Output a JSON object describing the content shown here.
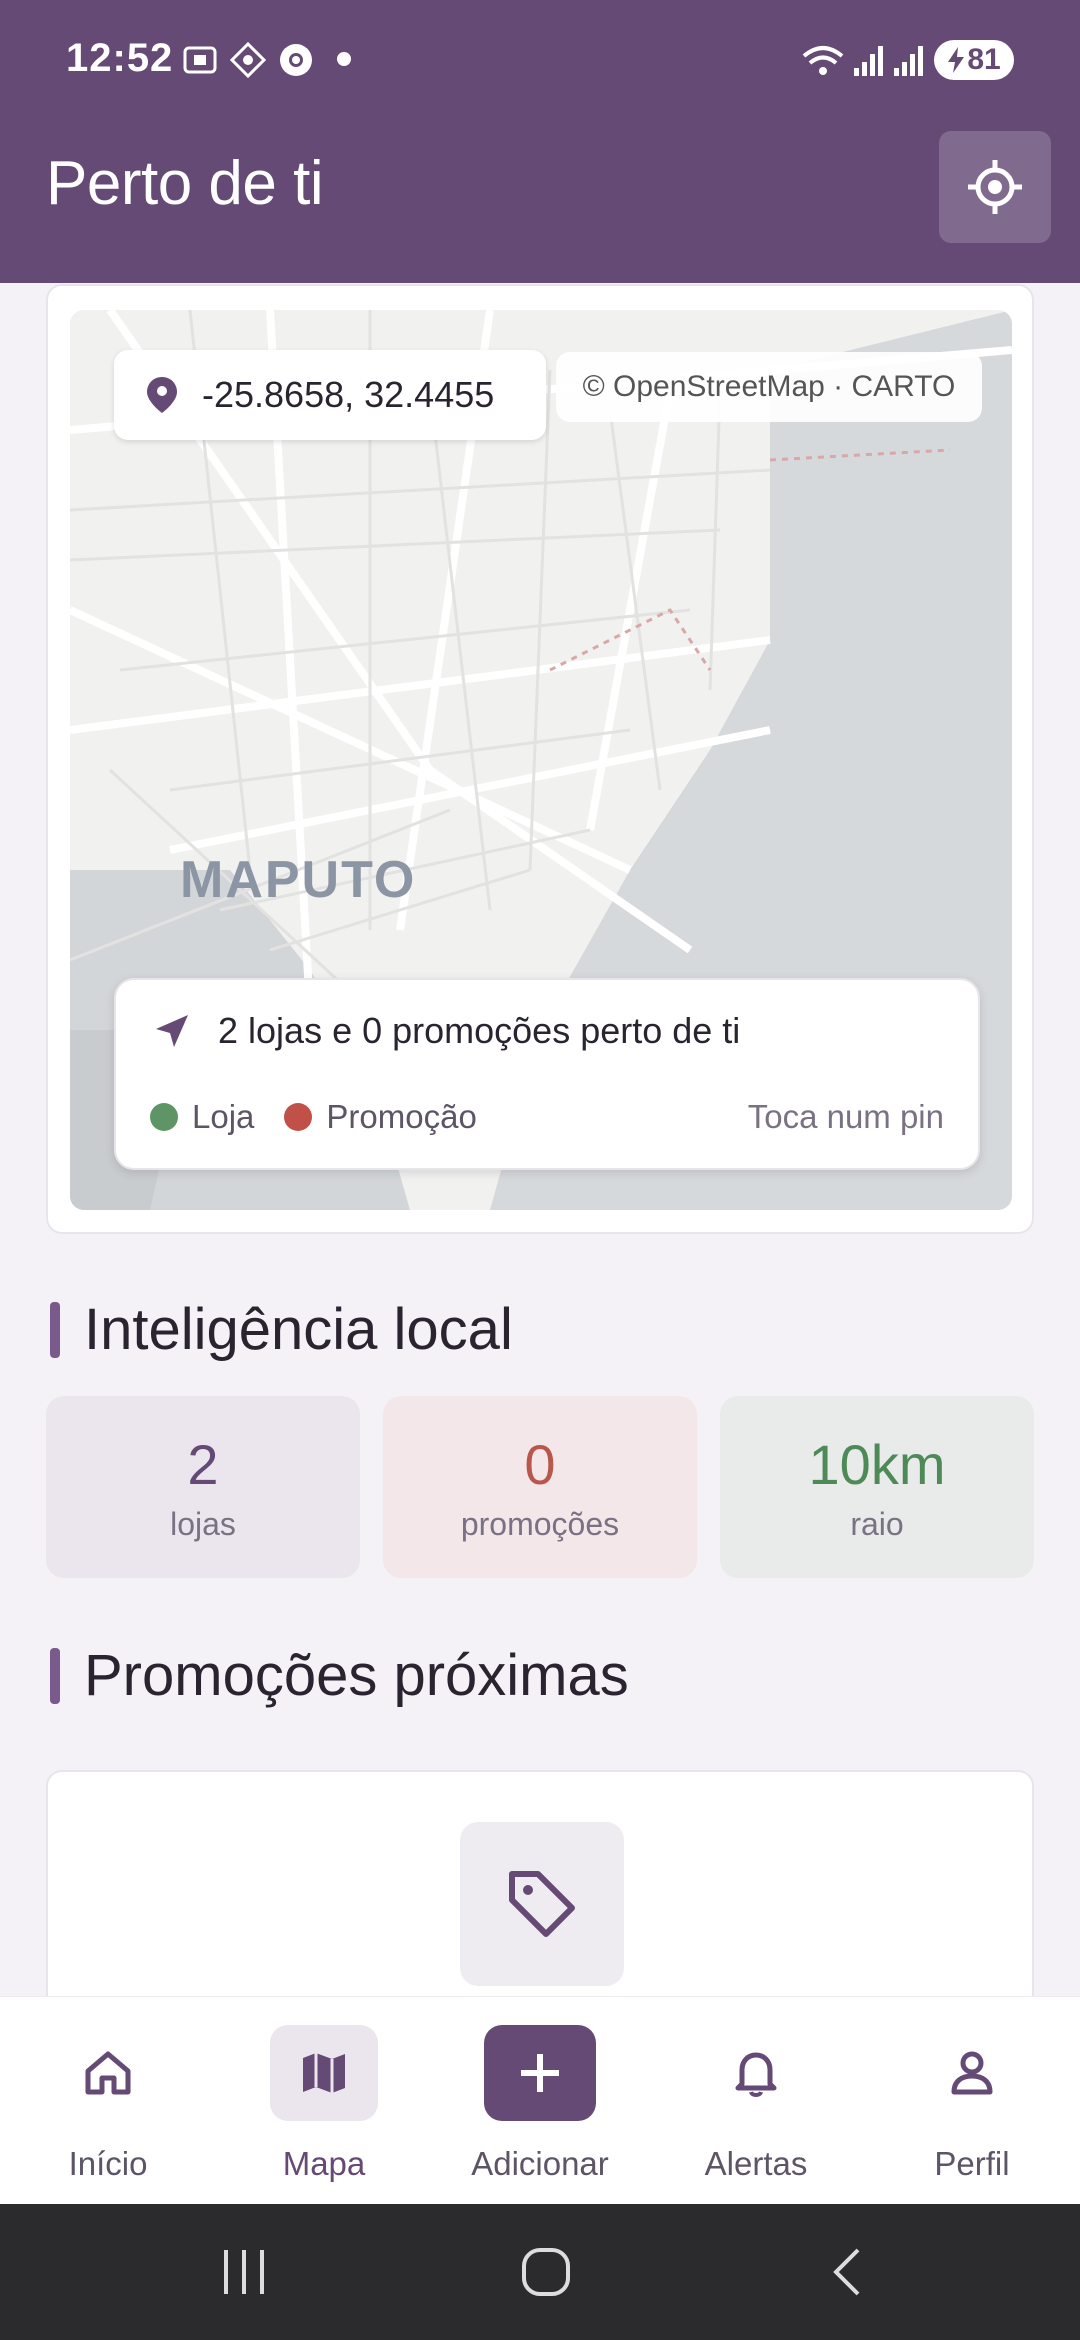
{
  "status_bar": {
    "time": "12:52",
    "battery": "81",
    "icons": [
      "screenshot-icon",
      "app-icon",
      "chrome-icon",
      "wifi-icon",
      "signal-icon",
      "signal-icon"
    ]
  },
  "header": {
    "title": "Perto de ti",
    "locate_icon": "crosshair-icon"
  },
  "map": {
    "coordinates": "-25.8658, 32.4455",
    "attribution": "© OpenStreetMap · CARTO",
    "city_label": "MAPUTO",
    "summary": "2 lojas e 0 promoções perto de ti",
    "legend": [
      {
        "label": "Loja",
        "color": "#5e9466"
      },
      {
        "label": "Promoção",
        "color": "#c05048"
      }
    ],
    "hint": "Toca num pin"
  },
  "local_intel": {
    "title": "Inteligência local",
    "stats": [
      {
        "value": "2",
        "label": "lojas",
        "color": "#644a74",
        "bg": "#ebe6ee"
      },
      {
        "value": "0",
        "label": "promoções",
        "color": "#b9574c",
        "bg": "#f3e7ea"
      },
      {
        "value": "10km",
        "label": "raio",
        "color": "#4e8a58",
        "bg": "#e8ebea"
      }
    ]
  },
  "nearby_promos": {
    "title": "Promoções próximas",
    "empty_icon": "tag-icon"
  },
  "bottom_nav": {
    "items": [
      {
        "label": "Início",
        "icon": "home-icon",
        "active": false
      },
      {
        "label": "Mapa",
        "icon": "map-icon",
        "active": true
      },
      {
        "label": "Adicionar",
        "icon": "plus-icon",
        "active": false
      },
      {
        "label": "Alertas",
        "icon": "bell-icon",
        "active": false
      },
      {
        "label": "Perfil",
        "icon": "user-icon",
        "active": false
      }
    ]
  },
  "colors": {
    "primary": "#644a74",
    "background": "#f4f2f7"
  }
}
